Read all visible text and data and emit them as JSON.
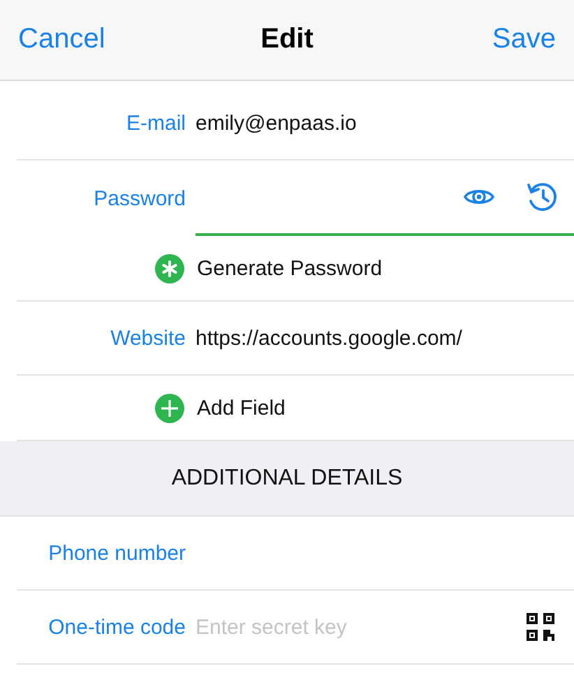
{
  "nav": {
    "left": "Cancel",
    "title": "Edit",
    "right": "Save"
  },
  "rows": [
    {
      "kind": "field",
      "label": "E-mail",
      "value": "emily@enpaas.io"
    },
    {
      "kind": "password",
      "label": "Password",
      "focused": true
    },
    {
      "kind": "generate",
      "text": "Generate Password"
    },
    {
      "kind": "field",
      "label": "Website",
      "value": "https://accounts.google.com/"
    },
    {
      "kind": "add",
      "text": "Add Field"
    },
    {
      "kind": "header",
      "text": "ADDITIONAL DETAILS"
    },
    {
      "kind": "field",
      "label": "Phone number"
    },
    {
      "kind": "otp",
      "label": "One-time code",
      "placeholder": "Enter secret key"
    }
  ]
}
